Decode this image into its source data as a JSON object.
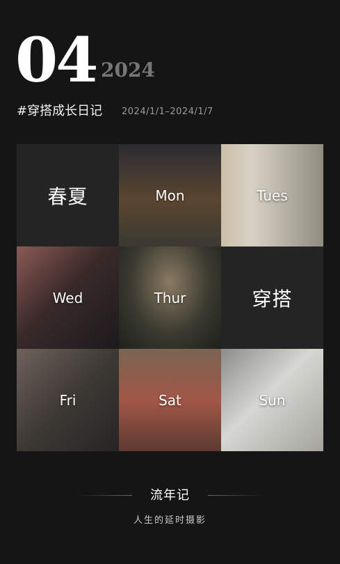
{
  "header": {
    "number": "04",
    "year": "2024",
    "tagline": "#穿搭成长日记",
    "date_range": "2024/1/1–2024/1/7"
  },
  "grid": {
    "tiles": [
      {
        "type": "text",
        "label": "春夏"
      },
      {
        "type": "photo",
        "label": "Mon"
      },
      {
        "type": "photo",
        "label": "Tues"
      },
      {
        "type": "photo",
        "label": "Wed"
      },
      {
        "type": "photo",
        "label": "Thur"
      },
      {
        "type": "text",
        "label": "穿搭"
      },
      {
        "type": "photo",
        "label": "Fri"
      },
      {
        "type": "photo",
        "label": "Sat"
      },
      {
        "type": "photo",
        "label": "Sun"
      }
    ]
  },
  "footer": {
    "title": "流年记",
    "subtitle": "人生的延时摄影"
  },
  "colors": {
    "background": "#151515",
    "text_tile": "#242424",
    "year": "#777777",
    "date_range": "#9b9b9b"
  }
}
